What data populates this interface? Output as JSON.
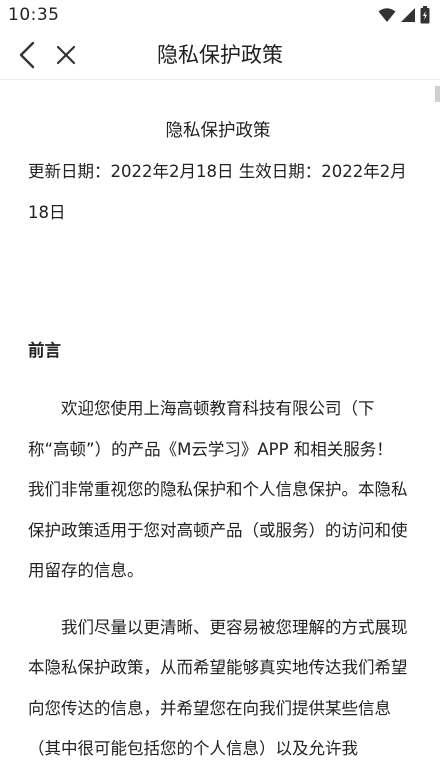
{
  "status_bar": {
    "time": "10:35",
    "icons": [
      "wifi-icon",
      "signal-icon",
      "battery-icon"
    ]
  },
  "nav": {
    "title": "隐私保护政策",
    "back_icon": "chevron-left-icon",
    "close_icon": "close-icon"
  },
  "document": {
    "title": "隐私保护政策",
    "date_line": "更新日期：2022年2月18日 生效日期：2022年2月18日",
    "section_heading": "前言",
    "paragraphs": [
      "欢迎您使用上海高顿教育科技有限公司（下称“高顿”）的产品《M云学习》APP 和相关服务！我们非常重视您的隐私保护和个人信息保护。本隐私保护政策适用于您对高顿产品（或服务）的访问和使用留存的信息。",
      "我们尽量以更清晰、更容易被您理解的方式展现本隐私保护政策，从而希望能够真实地传达我们希望向您传达的信息，并希望您在向我们提供某些信息（其中很可能包括您的个人信息）以及允许我"
    ]
  },
  "colors": {
    "background": "#ffffff",
    "text": "#222222",
    "divider": "#eeeeee",
    "scrollbar": "#cfcfcf"
  }
}
